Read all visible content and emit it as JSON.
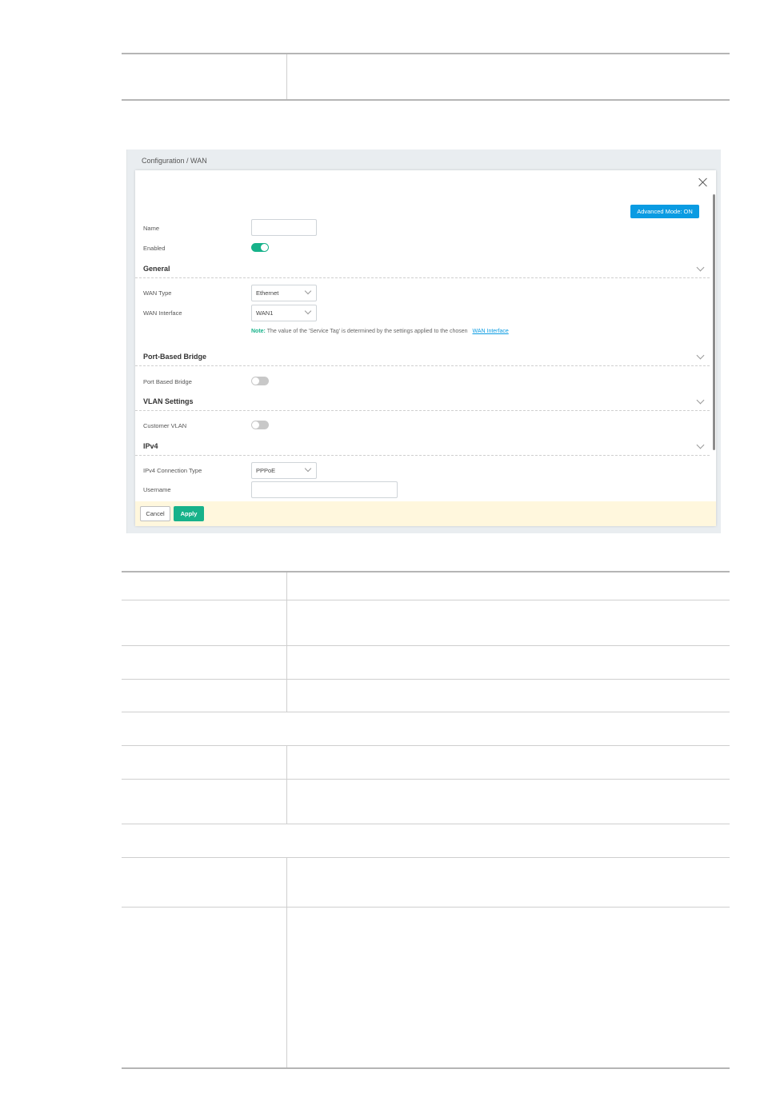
{
  "screenshot": {
    "breadcrumb": "Configuration / WAN",
    "advanced_mode_label": "Advanced Mode: ON",
    "fields": {
      "name_label": "Name",
      "name_value": "",
      "enabled_label": "Enabled",
      "enabled_state": "on",
      "wan_type_label": "WAN Type",
      "wan_type_value": "Ethernet",
      "wan_interface_label": "WAN Interface",
      "wan_interface_value": "WAN1",
      "port_based_bridge_label": "Port Based Bridge",
      "port_based_bridge_state": "off",
      "customer_vlan_label": "Customer VLAN",
      "customer_vlan_state": "off",
      "ipv4_connection_type_label": "IPv4 Connection Type",
      "ipv4_connection_type_value": "PPPoE",
      "username_label": "Username",
      "username_value": ""
    },
    "sections": {
      "general": "General",
      "port_based_bridge": "Port-Based Bridge",
      "vlan_settings": "VLAN Settings",
      "ipv4": "IPv4"
    },
    "note": {
      "key": "Note:",
      "text": "The value of the 'Service Tag' is determined by the settings applied to the chosen",
      "link": "WAN Interface"
    },
    "buttons": {
      "cancel": "Cancel",
      "apply": "Apply"
    },
    "colors": {
      "accent_green": "#17b28a",
      "accent_blue": "#0a9be2",
      "footer_bg": "#fff7dd"
    }
  }
}
